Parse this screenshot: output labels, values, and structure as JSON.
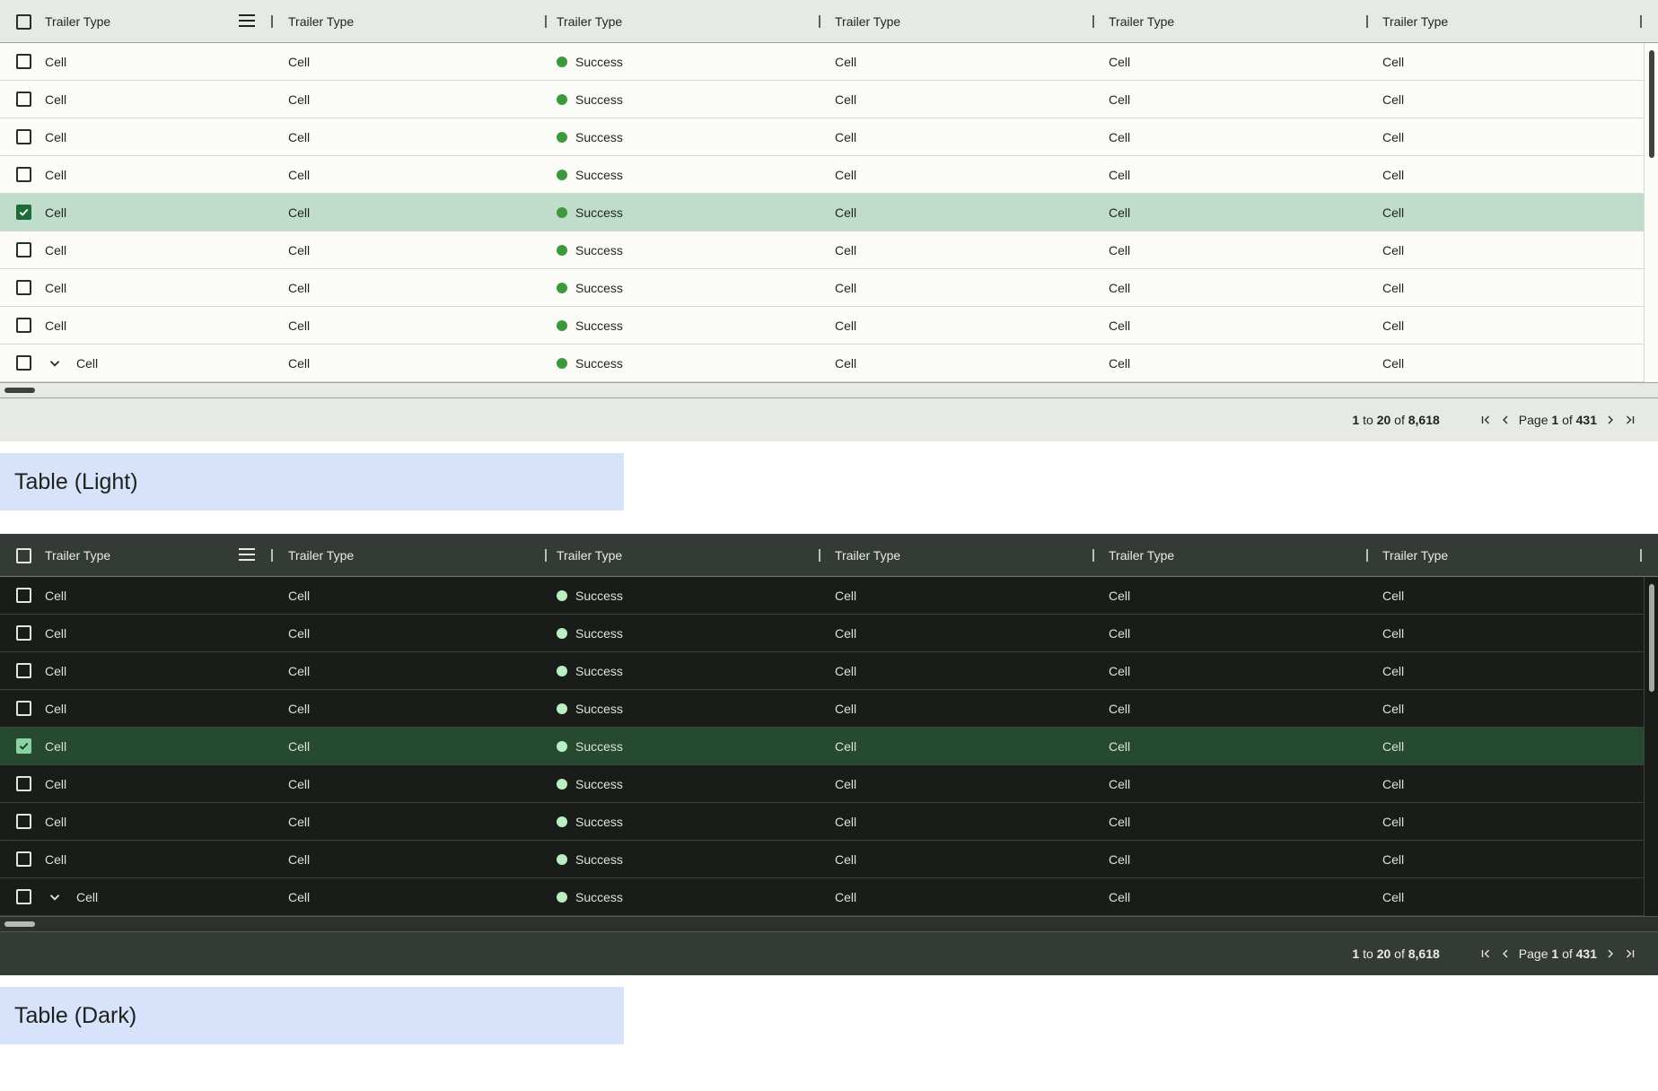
{
  "columns": [
    "Trailer Type",
    "Trailer Type",
    "Trailer Type",
    "Trailer Type",
    "Trailer Type",
    "Trailer Type"
  ],
  "rows": [
    {
      "checked": false,
      "expandable": false,
      "c0": "Cell",
      "c1": "Cell",
      "status": "Success",
      "c3": "Cell",
      "c4": "Cell",
      "c5": "Cell"
    },
    {
      "checked": false,
      "expandable": false,
      "c0": "Cell",
      "c1": "Cell",
      "status": "Success",
      "c3": "Cell",
      "c4": "Cell",
      "c5": "Cell"
    },
    {
      "checked": false,
      "expandable": false,
      "c0": "Cell",
      "c1": "Cell",
      "status": "Success",
      "c3": "Cell",
      "c4": "Cell",
      "c5": "Cell"
    },
    {
      "checked": false,
      "expandable": false,
      "c0": "Cell",
      "c1": "Cell",
      "status": "Success",
      "c3": "Cell",
      "c4": "Cell",
      "c5": "Cell"
    },
    {
      "checked": true,
      "expandable": false,
      "c0": "Cell",
      "c1": "Cell",
      "status": "Success",
      "c3": "Cell",
      "c4": "Cell",
      "c5": "Cell"
    },
    {
      "checked": false,
      "expandable": false,
      "c0": "Cell",
      "c1": "Cell",
      "status": "Success",
      "c3": "Cell",
      "c4": "Cell",
      "c5": "Cell"
    },
    {
      "checked": false,
      "expandable": false,
      "c0": "Cell",
      "c1": "Cell",
      "status": "Success",
      "c3": "Cell",
      "c4": "Cell",
      "c5": "Cell"
    },
    {
      "checked": false,
      "expandable": false,
      "c0": "Cell",
      "c1": "Cell",
      "status": "Success",
      "c3": "Cell",
      "c4": "Cell",
      "c5": "Cell"
    },
    {
      "checked": false,
      "expandable": true,
      "c0": "Cell",
      "c1": "Cell",
      "status": "Success",
      "c3": "Cell",
      "c4": "Cell",
      "c5": "Cell"
    }
  ],
  "pagination": {
    "range_start": "1",
    "range_to": "to",
    "range_end": "20",
    "range_of": "of",
    "total": "8,618",
    "page_word": "Page",
    "page": "1",
    "page_of": "of",
    "page_total": "431"
  },
  "labels": {
    "light": "Table (Light)",
    "dark": "Table (Dark)"
  },
  "icons": {
    "header_menu": "menu-icon",
    "row_checkbox": "checkbox",
    "expand": "chevron-down-icon",
    "status": "status-dot-icon",
    "first": "first-page-icon",
    "prev": "prev-page-icon",
    "next": "next-page-icon",
    "last": "last-page-icon"
  },
  "colors": {
    "light_selected_row": "#c0dccb",
    "dark_selected_row": "#254a30",
    "light_status_dot": "#3c9a3c",
    "dark_status_dot": "#b9efc3",
    "label_background": "#d7e2fb"
  }
}
